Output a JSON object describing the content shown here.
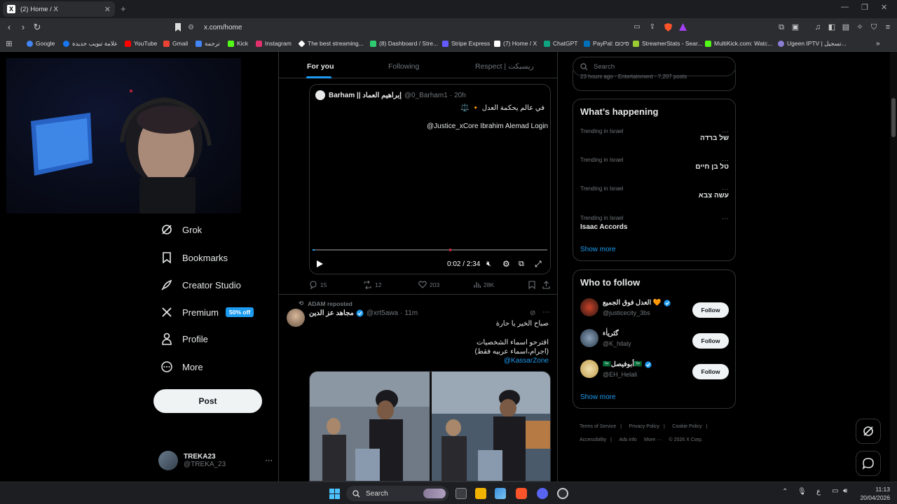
{
  "browser": {
    "tab_title": "(2) Home / X",
    "url": "x.com/home",
    "bookmarks": [
      {
        "label": "Google",
        "color": "#4285f4"
      },
      {
        "label": "علامة تبويب جديدة",
        "color": "#1877f2"
      },
      {
        "label": "YouTube",
        "color": "#ff0000"
      },
      {
        "label": "Gmail",
        "color": "#ea4335"
      },
      {
        "label": "ترجمة",
        "color": "#4285f4"
      },
      {
        "label": "Kick",
        "color": "#53fc18"
      },
      {
        "label": "Instagram",
        "color": "#e1306c"
      },
      {
        "label": "The best streaming...",
        "color": "#ffffff"
      },
      {
        "label": "(8) Dashboard / Stre...",
        "color": "#2ecc71"
      },
      {
        "label": "Stripe Express",
        "color": "#635bff"
      },
      {
        "label": "(7) Home / X",
        "color": "#ffffff"
      },
      {
        "label": "ChatGPT",
        "color": "#10a37f"
      },
      {
        "label": "PayPal: סיכום",
        "color": "#0070ba"
      },
      {
        "label": "StreamerStats - Sear...",
        "color": "#9acd32"
      },
      {
        "label": "MultiKick.com: Watc...",
        "color": "#53fc18"
      },
      {
        "label": "Ugeen IPTV | تسجيل...",
        "color": "#8a7fd4"
      }
    ]
  },
  "sidebar": {
    "items": [
      {
        "label": "Grok",
        "icon": "grok-icon"
      },
      {
        "label": "Bookmarks",
        "icon": "bookmark-icon"
      },
      {
        "label": "Creator Studio",
        "icon": "rocket-icon"
      },
      {
        "label": "Premium",
        "icon": "x-logo-icon",
        "badge": "50% off"
      },
      {
        "label": "Profile",
        "icon": "person-icon"
      },
      {
        "label": "More",
        "icon": "more-circle-icon"
      }
    ],
    "post_label": "Post",
    "user_name": "TREKA23",
    "user_handle": "@TREKA_23",
    "user_more": "···"
  },
  "feed": {
    "tabs": [
      "For you",
      "Following",
      "Respect | ريسبكت"
    ],
    "quote": {
      "author": "Barham || إبراهيم العماد",
      "handle": "@0_Barham1",
      "time": "20h",
      "line1": "في عالم يحكمة العدل 🔸 ⚖️",
      "line2": "@Justice_xCore Ibrahim Alemad Login",
      "video_time": "0:02 / 2:34",
      "progress": 0.01
    },
    "stats": {
      "replies": "15",
      "reposts": "12",
      "likes": "203",
      "views": "28K"
    },
    "post2": {
      "repost_by": "ADAM reposted",
      "author": "مجاهد عز الدين",
      "handle": "@xrt5awa",
      "time": "11m",
      "text1": "صباح الخير يا حارة",
      "text2": "اقترحو اسماء الشخصيات",
      "text3": "(اجرام،اسماء عربيه فقط)",
      "mention": "@KassarZone"
    }
  },
  "right": {
    "search_placeholder": "Search",
    "top_meta": "23 hours ago · Entertainment · 7,207 posts",
    "happening_title": "What’s happening",
    "trends": [
      {
        "meta": "Trending in Israel",
        "name": "של ברדה"
      },
      {
        "meta": "Trending in Israel",
        "name": "טל בן חיים"
      },
      {
        "meta": "Trending in Israel",
        "name": "עשה צבא"
      },
      {
        "meta": "Trending in Israel",
        "name": "Isaac Accords"
      }
    ],
    "show_more": "Show more",
    "who_title": "Who to follow",
    "follows": [
      {
        "name": "العدل فوق الجميع 🧡",
        "handle": "@justicecity_3bs",
        "btn": "Follow"
      },
      {
        "name": "گثرياٰء",
        "handle": "@K_hilaly",
        "btn": "Follow"
      },
      {
        "name": "🇸🇦أبوفيصل🇸🇦",
        "handle": "@EH_Helali",
        "btn": "Follow"
      }
    ],
    "footer": [
      "Terms of Service",
      "Privacy Policy",
      "Cookie Policy",
      "Accessibility",
      "Ads info",
      "More ···",
      "© 2026 X Corp."
    ]
  },
  "taskbar": {
    "search": "Search",
    "lang": "ع",
    "time": "11:13",
    "date": "20/04/2026"
  }
}
